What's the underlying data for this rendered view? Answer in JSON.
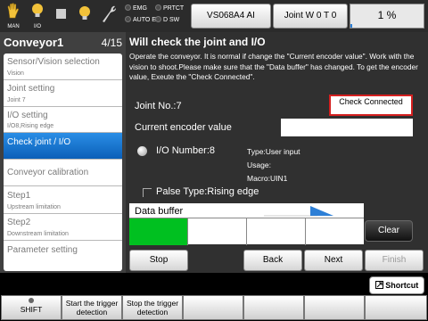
{
  "status_bar": {
    "man_label": "MAN",
    "io_label": "I/O",
    "lamps": [
      {
        "label": "EMG"
      },
      {
        "label": "PRTCT"
      },
      {
        "label": "AUTO EN"
      },
      {
        "label": "D SW"
      }
    ],
    "robot_model": "VS068A4 AI",
    "joint_pos": "Joint  W 0 T 0",
    "speed_text": "1 %",
    "speed_value": 1,
    "accent_color": "#2d7fd6"
  },
  "left_panel": {
    "title": "Conveyor1",
    "page": "4/15",
    "steps": [
      {
        "label": "Sensor/Vision selection",
        "sub": "Vision"
      },
      {
        "label": "Joint setting",
        "sub": "Joint 7"
      },
      {
        "label": "I/O setting",
        "sub": "I/O8,Rising edge"
      },
      {
        "label": "Check joint / I/O",
        "sub": ""
      },
      {
        "label": "Conveyor calibration",
        "sub": ""
      },
      {
        "label": "Step1",
        "sub": "Upstream limitation"
      },
      {
        "label": "Step2",
        "sub": "Downstream limitation"
      },
      {
        "label": "Parameter setting",
        "sub": ""
      }
    ],
    "active_index": 3
  },
  "main": {
    "title": "Will check the joint and I/O",
    "description": "Operate the conveyor. It is normal if change the \"Current encoder value\". Work with the vision to shoot.Please make sure that the \"Data buffer\" has changed. To get the encoder value, Exeute the \"Check Connected\".",
    "joint_no": "Joint No.:7",
    "check_connected": "Check Connected",
    "encoder_label": "Current encoder value",
    "encoder_value": "",
    "io_number": "I/O Number:8",
    "io_type": "Type:User input",
    "io_usage": "Usage:",
    "io_macro": "Macro:UIN1",
    "pulse_type": "Palse Type:Rising edge",
    "data_buffer_label": "Data buffer",
    "buffer_fill_color": "#00c020",
    "clear_label": "Clear",
    "buttons": {
      "stop": "Stop",
      "back": "Back",
      "next": "Next",
      "finish": "Finish"
    }
  },
  "bottom": {
    "shortcut_label": "Shortcut",
    "fkeys": [
      {
        "label": "SHIFT"
      },
      {
        "label": "Start the trigger detection"
      },
      {
        "label": "Stop the trigger detection"
      },
      {
        "label": ""
      },
      {
        "label": ""
      },
      {
        "label": ""
      },
      {
        "label": ""
      }
    ]
  }
}
